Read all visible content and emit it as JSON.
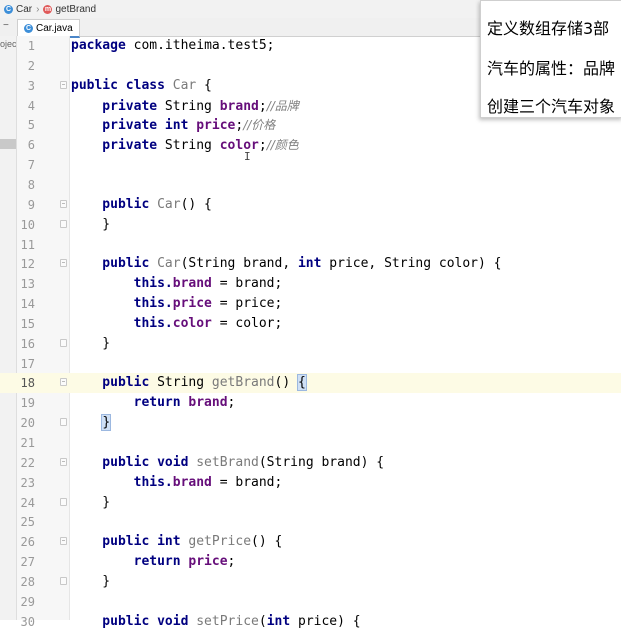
{
  "breadcrumb": [
    {
      "label": "Car",
      "icon": "class-icon",
      "color": "#3d8fd9"
    },
    {
      "label": "getBrand",
      "icon": "method-icon",
      "color": "#e05a5a"
    }
  ],
  "tab": {
    "label": "Car.java",
    "icon": "class-icon"
  },
  "project_panel": {
    "label": "ojec"
  },
  "overlay": {
    "lines": [
      "定义数组存储3部",
      "汽车的属性：品牌",
      "创建三个汽车对象"
    ]
  },
  "editor": {
    "current_line": 18,
    "lines": [
      {
        "n": "1",
        "tokens": [
          {
            "t": "package ",
            "c": "kw"
          },
          {
            "t": "com.itheima.test5;",
            "c": "plain"
          }
        ]
      },
      {
        "n": "2",
        "tokens": []
      },
      {
        "n": "3",
        "tokens": [
          {
            "t": "public class ",
            "c": "kw"
          },
          {
            "t": "Car",
            "c": "mname"
          },
          {
            "t": " {",
            "c": "plain"
          }
        ]
      },
      {
        "n": "4",
        "tokens": [
          {
            "t": "    private ",
            "c": "kw"
          },
          {
            "t": "String ",
            "c": "plain"
          },
          {
            "t": "brand",
            "c": "fld"
          },
          {
            "t": ";",
            "c": "plain"
          },
          {
            "t": "//品牌",
            "c": "cmt"
          }
        ]
      },
      {
        "n": "5",
        "tokens": [
          {
            "t": "    private int ",
            "c": "kw"
          },
          {
            "t": "price",
            "c": "fld"
          },
          {
            "t": ";",
            "c": "plain"
          },
          {
            "t": "//价格",
            "c": "cmt"
          }
        ]
      },
      {
        "n": "6",
        "tokens": [
          {
            "t": "    private ",
            "c": "kw"
          },
          {
            "t": "String ",
            "c": "plain"
          },
          {
            "t": "color",
            "c": "fld"
          },
          {
            "t": ";",
            "c": "plain"
          },
          {
            "t": "//颜色",
            "c": "cmt"
          }
        ]
      },
      {
        "n": "7",
        "tokens": []
      },
      {
        "n": "8",
        "tokens": []
      },
      {
        "n": "9",
        "tokens": [
          {
            "t": "    public ",
            "c": "kw"
          },
          {
            "t": "Car",
            "c": "mname"
          },
          {
            "t": "() {",
            "c": "plain"
          }
        ]
      },
      {
        "n": "10",
        "tokens": [
          {
            "t": "    }",
            "c": "plain"
          }
        ]
      },
      {
        "n": "11",
        "tokens": []
      },
      {
        "n": "12",
        "tokens": [
          {
            "t": "    public ",
            "c": "kw"
          },
          {
            "t": "Car",
            "c": "mname"
          },
          {
            "t": "(String brand, ",
            "c": "plain"
          },
          {
            "t": "int ",
            "c": "kw"
          },
          {
            "t": "price, String color) {",
            "c": "plain"
          }
        ]
      },
      {
        "n": "13",
        "tokens": [
          {
            "t": "        this.",
            "c": "kw"
          },
          {
            "t": "brand",
            "c": "fld"
          },
          {
            "t": " = brand;",
            "c": "plain"
          }
        ]
      },
      {
        "n": "14",
        "tokens": [
          {
            "t": "        this.",
            "c": "kw"
          },
          {
            "t": "price",
            "c": "fld"
          },
          {
            "t": " = price;",
            "c": "plain"
          }
        ]
      },
      {
        "n": "15",
        "tokens": [
          {
            "t": "        this.",
            "c": "kw"
          },
          {
            "t": "color",
            "c": "fld"
          },
          {
            "t": " = color;",
            "c": "plain"
          }
        ]
      },
      {
        "n": "16",
        "tokens": [
          {
            "t": "    }",
            "c": "plain"
          }
        ]
      },
      {
        "n": "17",
        "tokens": []
      },
      {
        "n": "18",
        "tokens": [
          {
            "t": "    public ",
            "c": "kw"
          },
          {
            "t": "String ",
            "c": "plain"
          },
          {
            "t": "getBrand",
            "c": "mname"
          },
          {
            "t": "() ",
            "c": "plain"
          },
          {
            "t": "{",
            "c": "brace-hl"
          }
        ]
      },
      {
        "n": "19",
        "tokens": [
          {
            "t": "        return ",
            "c": "kw"
          },
          {
            "t": "brand",
            "c": "fld"
          },
          {
            "t": ";",
            "c": "plain"
          }
        ]
      },
      {
        "n": "20",
        "tokens": [
          {
            "t": "    ",
            "c": "plain"
          },
          {
            "t": "}",
            "c": "brace-hl"
          }
        ]
      },
      {
        "n": "21",
        "tokens": []
      },
      {
        "n": "22",
        "tokens": [
          {
            "t": "    public void ",
            "c": "kw"
          },
          {
            "t": "setBrand",
            "c": "mname"
          },
          {
            "t": "(String brand) {",
            "c": "plain"
          }
        ]
      },
      {
        "n": "23",
        "tokens": [
          {
            "t": "        this.",
            "c": "kw"
          },
          {
            "t": "brand",
            "c": "fld"
          },
          {
            "t": " = brand;",
            "c": "plain"
          }
        ]
      },
      {
        "n": "24",
        "tokens": [
          {
            "t": "    }",
            "c": "plain"
          }
        ]
      },
      {
        "n": "25",
        "tokens": []
      },
      {
        "n": "26",
        "tokens": [
          {
            "t": "    public int ",
            "c": "kw"
          },
          {
            "t": "getPrice",
            "c": "mname"
          },
          {
            "t": "() {",
            "c": "plain"
          }
        ]
      },
      {
        "n": "27",
        "tokens": [
          {
            "t": "        return ",
            "c": "kw"
          },
          {
            "t": "price",
            "c": "fld"
          },
          {
            "t": ";",
            "c": "plain"
          }
        ]
      },
      {
        "n": "28",
        "tokens": [
          {
            "t": "    }",
            "c": "plain"
          }
        ]
      },
      {
        "n": "29",
        "tokens": []
      },
      {
        "n": "30",
        "tokens": [
          {
            "t": "    public void ",
            "c": "kw"
          },
          {
            "t": "setPrice",
            "c": "mname"
          },
          {
            "t": "(",
            "c": "plain"
          },
          {
            "t": "int ",
            "c": "kw"
          },
          {
            "t": "price) {",
            "c": "plain"
          }
        ]
      }
    ]
  }
}
